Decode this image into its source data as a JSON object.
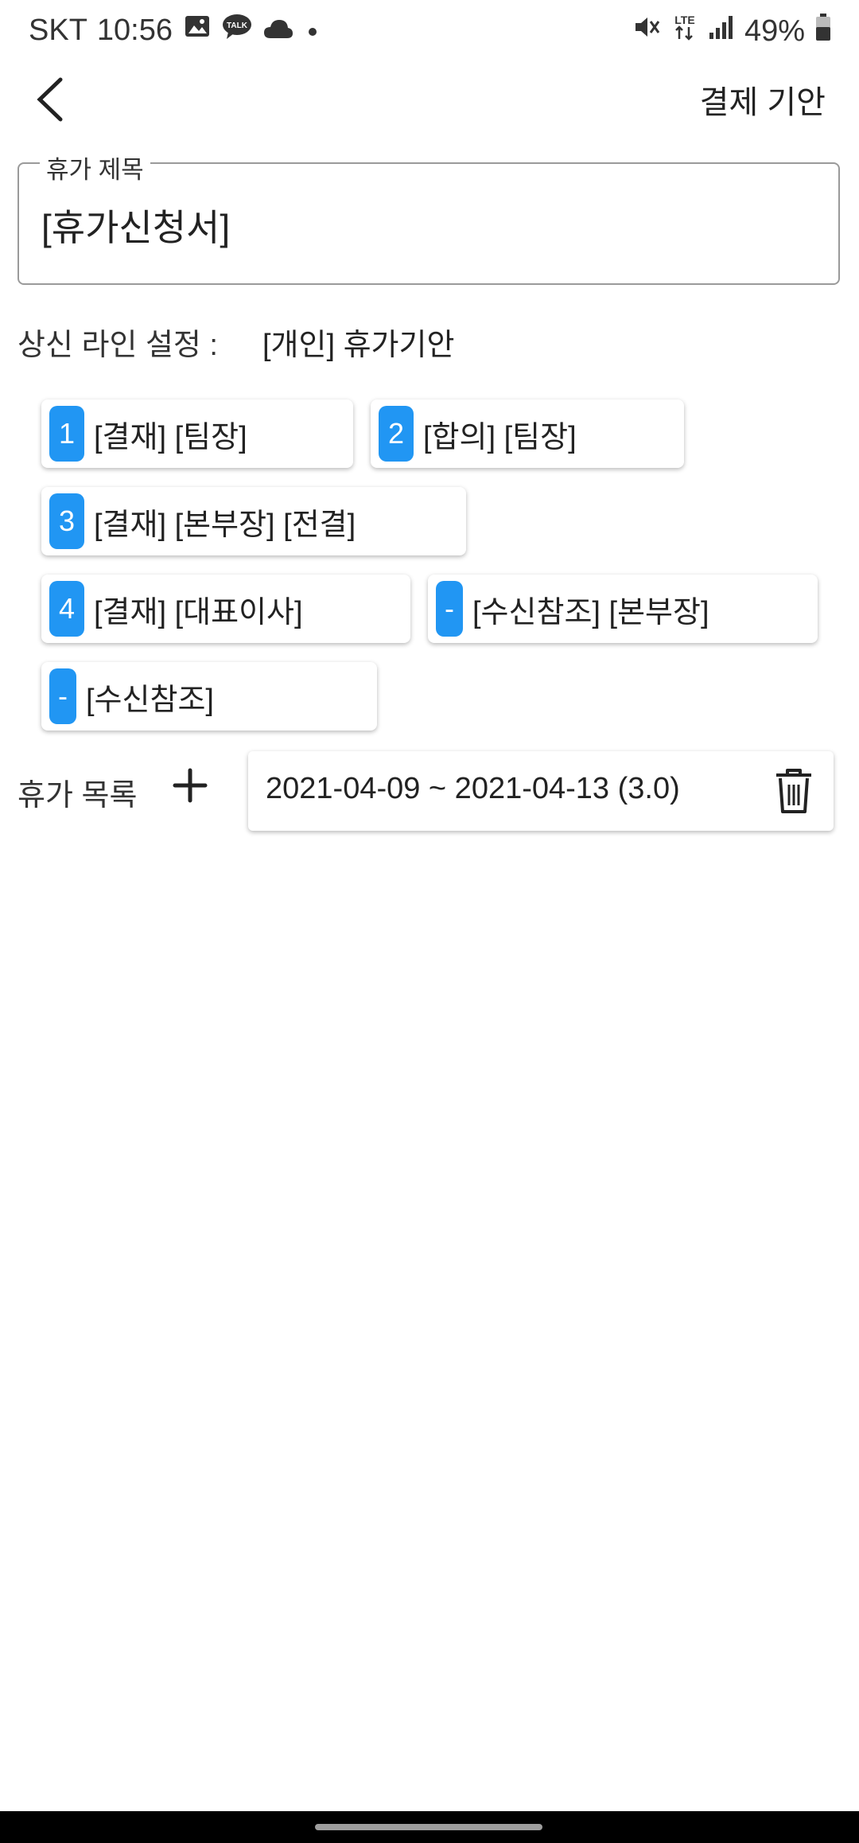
{
  "status_bar": {
    "carrier": "SKT",
    "time": "10:56",
    "battery": "49%",
    "network": "LTE",
    "icons": [
      "image-icon",
      "talk-icon",
      "cloud-icon",
      "dot-icon",
      "mute-icon",
      "lte-icon",
      "signal-icon",
      "battery-icon"
    ]
  },
  "header": {
    "back_icon": "chevron-left-icon",
    "submit_label": "결제 기안"
  },
  "title_field": {
    "label": "휴가 제목",
    "value": "[휴가신청서]"
  },
  "approval_line": {
    "label": "상신 라인 설정 :",
    "value": "[개인] 휴가기안",
    "chips": [
      {
        "badge": "1",
        "text": "[결재] [팀장]"
      },
      {
        "badge": "2",
        "text": "[합의] [팀장]"
      },
      {
        "badge": "3",
        "text": "[결재] [본부장] [전결]"
      },
      {
        "badge": "4",
        "text": "[결재] [대표이사]"
      },
      {
        "badge": "-",
        "text": "[수신참조] [본부장]"
      },
      {
        "badge": "-",
        "text": "[수신참조]"
      }
    ],
    "badge_color": "#2196f3"
  },
  "vacation_list": {
    "label": "휴가 목록",
    "add_icon": "plus-icon",
    "items": [
      {
        "text": "2021-04-09 ~ 2021-04-13 (3.0)",
        "delete_icon": "trash-icon"
      }
    ]
  }
}
